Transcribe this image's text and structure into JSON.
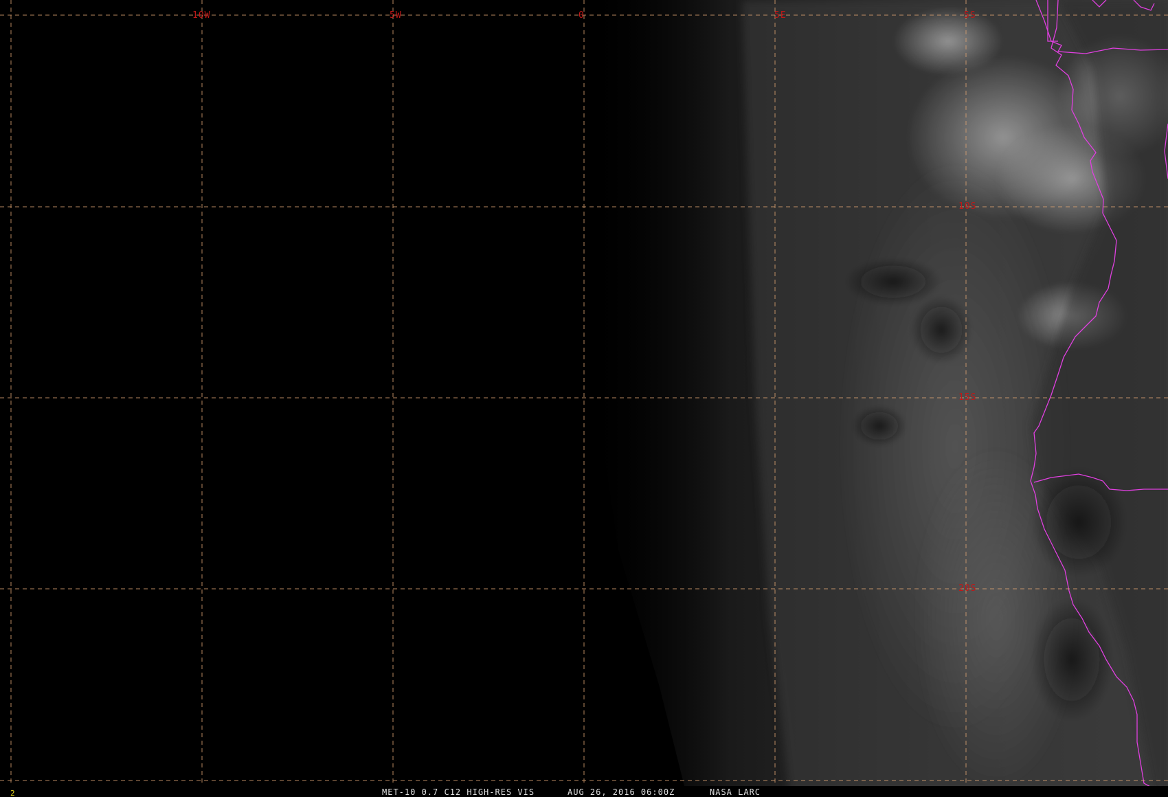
{
  "map": {
    "longitude_labels": [
      "10W",
      "5W",
      "0",
      "5E",
      "5S"
    ],
    "latitude_labels": [
      "10S",
      "15S",
      "20S"
    ],
    "caption": {
      "satellite": "MET-10 0.7 C12 HIGH-RES VIS",
      "datetime": "AUG 26, 2016 06:00Z",
      "source": "NASA LARC"
    },
    "frame_number": "2",
    "colors": {
      "background": "#000000",
      "grid_line": "#d9a070",
      "grid_label": "#c01818",
      "coastline_border": "#e040e0",
      "caption_text": "#e0e0e0",
      "frame_number": "#e3d21a"
    }
  }
}
